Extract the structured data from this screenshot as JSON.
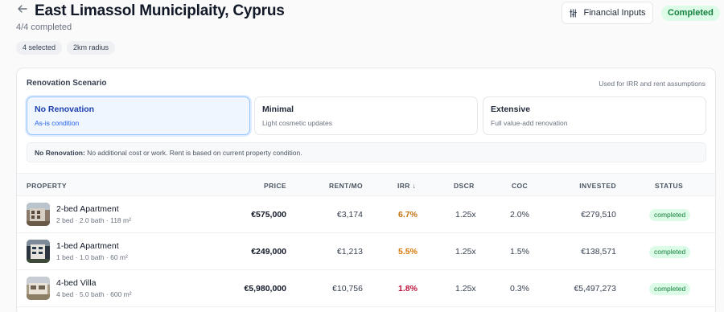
{
  "header": {
    "title": "East Limassol Municiplaity, Cyprus",
    "progress": "4/4 completed",
    "chips": [
      "4 selected",
      "2km radius"
    ],
    "financial_inputs_label": "Financial Inputs",
    "status": "Completed"
  },
  "renovation": {
    "title": "Renovation Scenario",
    "note": "Used for IRR and rent assumptions",
    "options": [
      {
        "name": "No Renovation",
        "desc": "As-is condition",
        "selected": true
      },
      {
        "name": "Minimal",
        "desc": "Light cosmetic updates",
        "selected": false
      },
      {
        "name": "Extensive",
        "desc": "Full value-add renovation",
        "selected": false
      }
    ],
    "info_label": "No Renovation:",
    "info_text": " No additional cost or work. Rent is based on current property condition."
  },
  "table": {
    "headers": {
      "property": "PROPERTY",
      "price": "PRICE",
      "rent": "RENT/MO",
      "irr": "IRR ↓",
      "dscr": "DSCR",
      "coc": "COC",
      "invested": "INVESTED",
      "status": "STATUS"
    },
    "rows": [
      {
        "name": "2-bed Apartment",
        "details": "2 bed · 2.0 bath · 118 m²",
        "price": "€575,000",
        "rent": "€3,174",
        "irr": "6.7%",
        "irr_color": "#c2710c",
        "dscr": "1.25x",
        "coc": "2.0%",
        "invested": "€279,510",
        "status": "completed"
      },
      {
        "name": "1-bed Apartment",
        "details": "1 bed · 1.0 bath · 60 m²",
        "price": "€249,000",
        "rent": "€1,213",
        "irr": "5.5%",
        "irr_color": "#d97706",
        "dscr": "1.25x",
        "coc": "1.5%",
        "invested": "€138,571",
        "status": "completed"
      },
      {
        "name": "4-bed Villa",
        "details": "4 bed · 5.0 bath · 600 m²",
        "price": "€5,980,000",
        "rent": "€10,756",
        "irr": "1.8%",
        "irr_color": "#be123c",
        "dscr": "1.25x",
        "coc": "0.3%",
        "invested": "€5,497,273",
        "status": "completed"
      }
    ]
  }
}
